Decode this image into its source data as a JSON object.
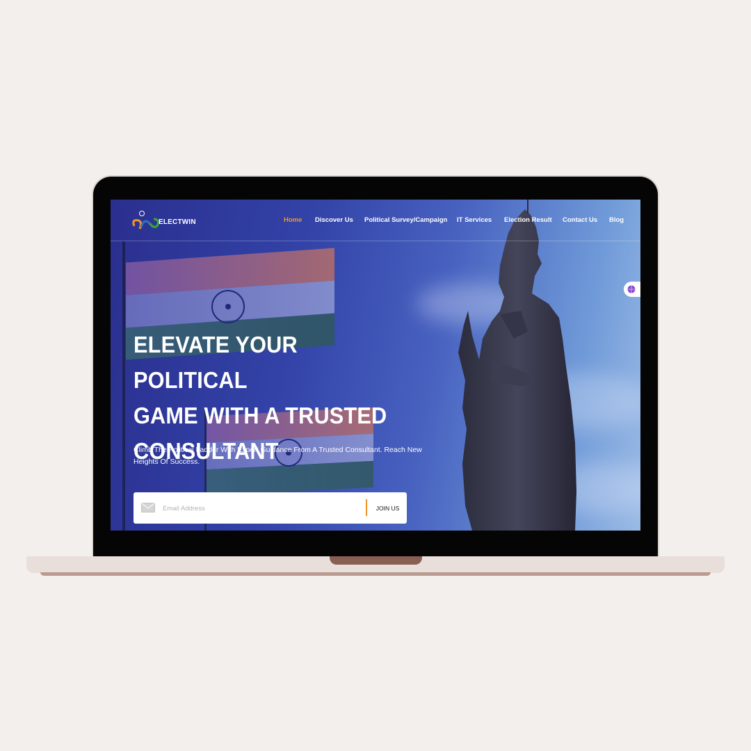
{
  "brand": {
    "name": "ELECTWIN",
    "colors": {
      "orange": "#f39325",
      "green": "#3aa43a",
      "blue": "#2f6fc0"
    }
  },
  "nav": {
    "items": [
      {
        "label": "Home",
        "active": true
      },
      {
        "label": "Discover Us",
        "active": false
      },
      {
        "label": "Political Survey/Campaign",
        "active": false
      },
      {
        "label": "IT Services",
        "active": false
      },
      {
        "label": "Election Result",
        "active": false
      },
      {
        "label": "Contact Us",
        "active": false
      },
      {
        "label": "Blog",
        "active": false
      }
    ]
  },
  "hero": {
    "title_lines": [
      "ELEVATE YOUR POLITICAL",
      "GAME WITH A TRUSTED",
      "CONSULTANT"
    ],
    "subtitle": "Climb The Political Ladder With Expert Guidance From A Trusted Consultant. Reach New Heights Of Success.",
    "signup": {
      "placeholder": "Email Address",
      "button_label": "JOIN US",
      "icon": "envelope-icon"
    }
  },
  "side_widget": {
    "icon": "globe-icon"
  }
}
